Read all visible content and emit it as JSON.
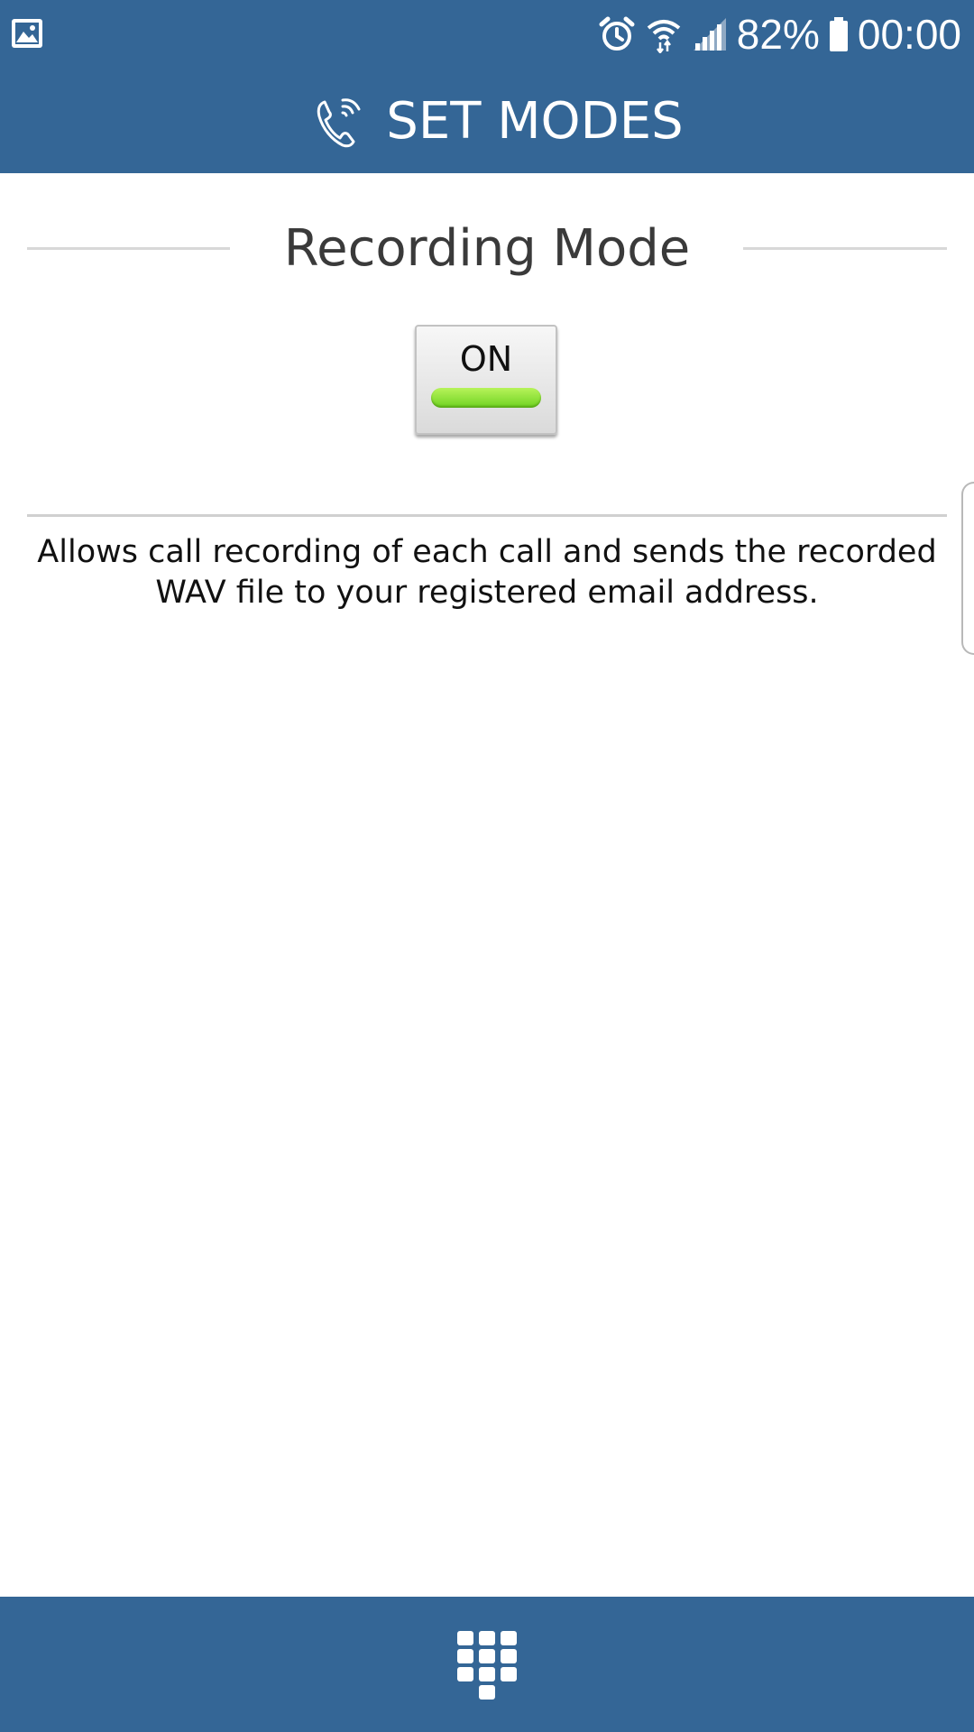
{
  "status_bar": {
    "battery": "82%",
    "time": "00:00",
    "left_icon": "image-notification-icon",
    "right_icons": [
      "alarm-icon",
      "wifi-icon",
      "signal-icon",
      "battery-icon"
    ]
  },
  "header": {
    "title": "SET MODES",
    "icon": "phone-wifi-icon"
  },
  "recording_mode": {
    "heading": "Recording Mode",
    "toggle_label": "ON",
    "toggle_state": "on",
    "description": "Allows call recording of each call and sends the recorded WAV file to your registered email address."
  },
  "bottom_bar": {
    "icon": "dialpad-icon"
  },
  "colors": {
    "primary": "#346696",
    "toggle_on": "#8ee03a",
    "heading_text": "#3a3a3a"
  }
}
